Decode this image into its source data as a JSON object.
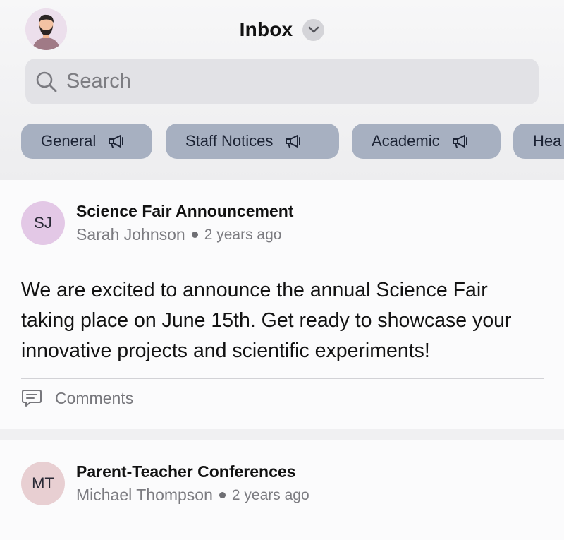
{
  "header": {
    "title": "Inbox",
    "search_placeholder": "Search"
  },
  "icons": {
    "avatar": "user-avatar",
    "dropdown": "chevron-down-icon",
    "search": "search-icon",
    "channel": "megaphone-icon",
    "comments": "comment-icon"
  },
  "channels": [
    {
      "label": "General"
    },
    {
      "label": "Staff Notices"
    },
    {
      "label": "Academic"
    },
    {
      "label": "Hea"
    }
  ],
  "posts": [
    {
      "initials": "SJ",
      "title": "Science Fair Announcement",
      "author": "Sarah Johnson",
      "time": "2 years ago",
      "body": "We are excited to announce the annual Science Fair taking place on June 15th. Get ready to showcase your innovative projects and scientific experiments!",
      "comments_label": "Comments",
      "avatar_color": "#e3c8e6"
    },
    {
      "initials": "MT",
      "title": "Parent-Teacher Conferences",
      "author": "Michael Thompson",
      "time": "2 years ago",
      "avatar_color": "#e8cfd2"
    }
  ],
  "colors": {
    "chip_bg": "#a7b0c1",
    "search_bg": "#e2e2e6"
  }
}
